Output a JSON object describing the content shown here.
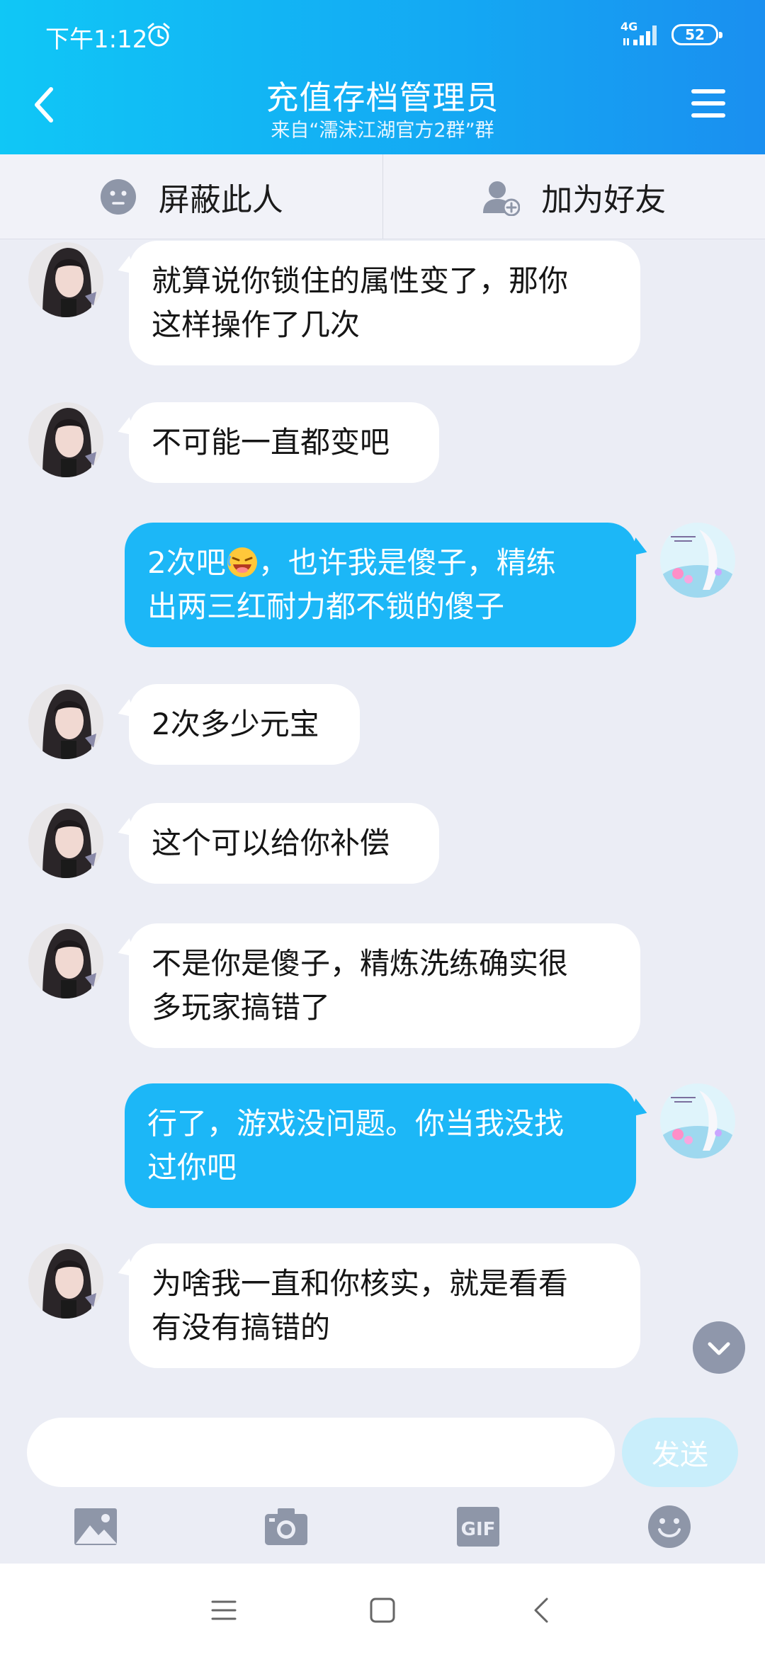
{
  "status_bar": {
    "time": "下午1:12",
    "network": "4G",
    "battery": "52"
  },
  "header": {
    "title": "充值存档管理员",
    "subtitle": "来自“濡沫江湖官方2群”群"
  },
  "actions": {
    "block_label": "屏蔽此人",
    "add_friend_label": "加为好友"
  },
  "messages": [
    {
      "side": "in",
      "line1": "就算说你锁住的属性变了，那你",
      "line2": "这样操作了几次"
    },
    {
      "side": "in",
      "line1": "不可能一直都变吧"
    },
    {
      "side": "out",
      "line1_pre": "2次吧",
      "emoji": "laughing-face-emoji",
      "line1_post": "，也许我是傻子，精练",
      "line2": "出两三红耐力都不锁的傻子"
    },
    {
      "side": "in",
      "line1": "2次多少元宝"
    },
    {
      "side": "in",
      "line1": "这个可以给你补偿"
    },
    {
      "side": "in",
      "line1": "不是你是傻子，精炼洗练确实很",
      "line2": "多玩家搞错了"
    },
    {
      "side": "out",
      "line1": "行了，游戏没问题。你当我没找",
      "line2": "过你吧"
    },
    {
      "side": "in",
      "line1": "为啥我一直和你核实，就是看看",
      "line2": "有没有搞错的"
    }
  ],
  "input": {
    "placeholder": "",
    "send_label": "发送"
  },
  "colors": {
    "header_start": "#10c7f6",
    "header_end": "#1a8ff0",
    "outgoing_bubble": "#1cb7f7",
    "incoming_bubble": "#ffffff",
    "background": "#ebedf5"
  },
  "icons": [
    "alarm-icon",
    "signal-icon",
    "back-arrow-icon",
    "menu-icon",
    "block-user-icon",
    "add-friend-icon",
    "chevron-down-icon",
    "image-icon",
    "camera-icon",
    "gif-icon",
    "emoji-face-icon",
    "nav-menu-icon",
    "nav-home-icon",
    "nav-back-icon"
  ]
}
